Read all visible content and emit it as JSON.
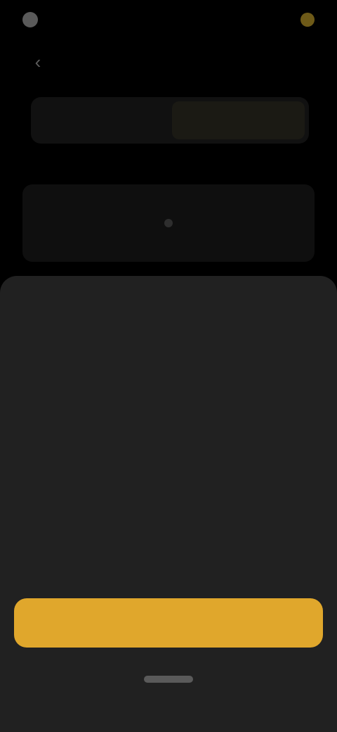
{
  "status_bar": {
    "time": "",
    "left_icon": "app-glyph",
    "right_icon": "notification-dot"
  },
  "nav": {
    "back_icon": "chevron-left-icon",
    "title": "",
    "action_label": ""
  },
  "segmented": {
    "options": [
      "",
      ""
    ],
    "selected_index": 1
  },
  "section": {
    "label": ""
  },
  "sheet": {
    "title": "",
    "paragraphs": [
      "",
      "",
      "",
      "",
      ""
    ],
    "primary_button_label": ""
  },
  "colors": {
    "accent": "#e0a72c",
    "sheet_background": "#212121",
    "page_background": "#000000"
  }
}
